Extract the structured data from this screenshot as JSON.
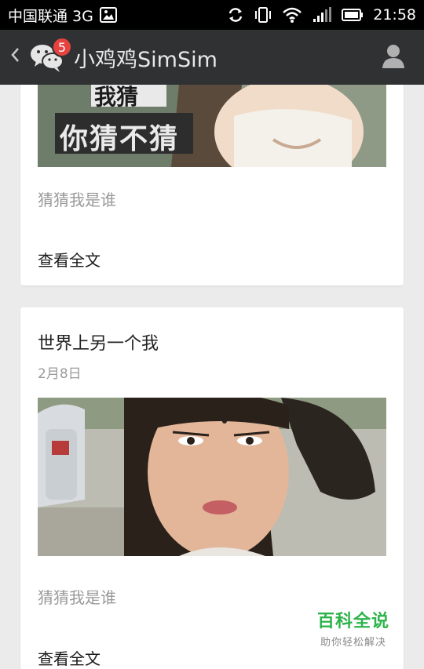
{
  "status_bar": {
    "carrier": "中国联通 3G",
    "time": "21:58",
    "icons": [
      "image-icon",
      "sync-icon",
      "vibrate-icon",
      "wifi-icon",
      "signal-icon",
      "battery-icon"
    ]
  },
  "app_bar": {
    "back_icon": "chevron-left-icon",
    "app_icon": "wechat-icon",
    "badge_count": "5",
    "title": "小鸡鸡SimSim",
    "profile_icon": "person-icon"
  },
  "articles": [
    {
      "image_caption": "你猜不猜",
      "image_caption_top": "我猜",
      "description": "猜猜我是谁",
      "read_more": "查看全文"
    },
    {
      "title": "世界上另一个我",
      "date": "2月8日",
      "description": "猜猜我是谁",
      "read_more": "查看全文"
    }
  ],
  "watermark": {
    "main": "百科全说",
    "sub": "助你轻松解决"
  },
  "colors": {
    "status_bar_bg": "#000000",
    "app_bar_bg": "#2f3133",
    "badge": "#e64340",
    "page_bg": "#ebebeb",
    "watermark_green": "#2db34a"
  }
}
